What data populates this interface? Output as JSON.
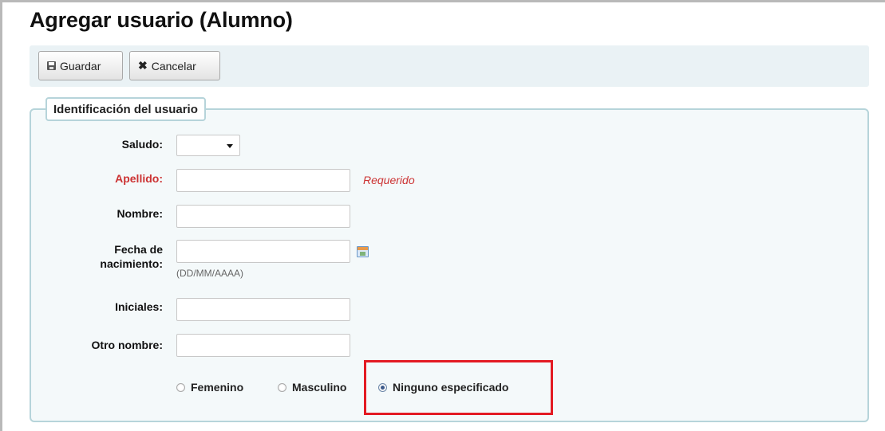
{
  "page": {
    "title": "Agregar usuario (Alumno)"
  },
  "toolbar": {
    "save_label": "Guardar",
    "cancel_label": "Cancelar"
  },
  "section": {
    "legend": "Identificación del usuario"
  },
  "form": {
    "saludo": {
      "label": "Saludo:",
      "value": ""
    },
    "apellido": {
      "label": "Apellido:",
      "value": "",
      "required_note": "Requerido",
      "required_color": "#cc3333"
    },
    "nombre": {
      "label": "Nombre:",
      "value": ""
    },
    "fecha": {
      "label_line1": "Fecha de",
      "label_line2": "nacimiento:",
      "value": "",
      "hint": "(DD/MM/AAAA)"
    },
    "iniciales": {
      "label": "Iniciales:",
      "value": ""
    },
    "otro_nombre": {
      "label": "Otro nombre:",
      "value": ""
    },
    "genero": {
      "options": [
        "Femenino",
        "Masculino",
        "Ninguno especificado"
      ],
      "selected": "Ninguno especificado"
    }
  },
  "icons": {
    "save": "save-icon",
    "cancel": "close-icon",
    "calendar": "calendar-icon",
    "dropdown": "chevron-down-icon"
  },
  "colors": {
    "toolbar_bg": "#eaf2f5",
    "fieldset_border": "#b6d4da",
    "required_text": "#cc3333",
    "highlight_box": "#e31b23"
  }
}
